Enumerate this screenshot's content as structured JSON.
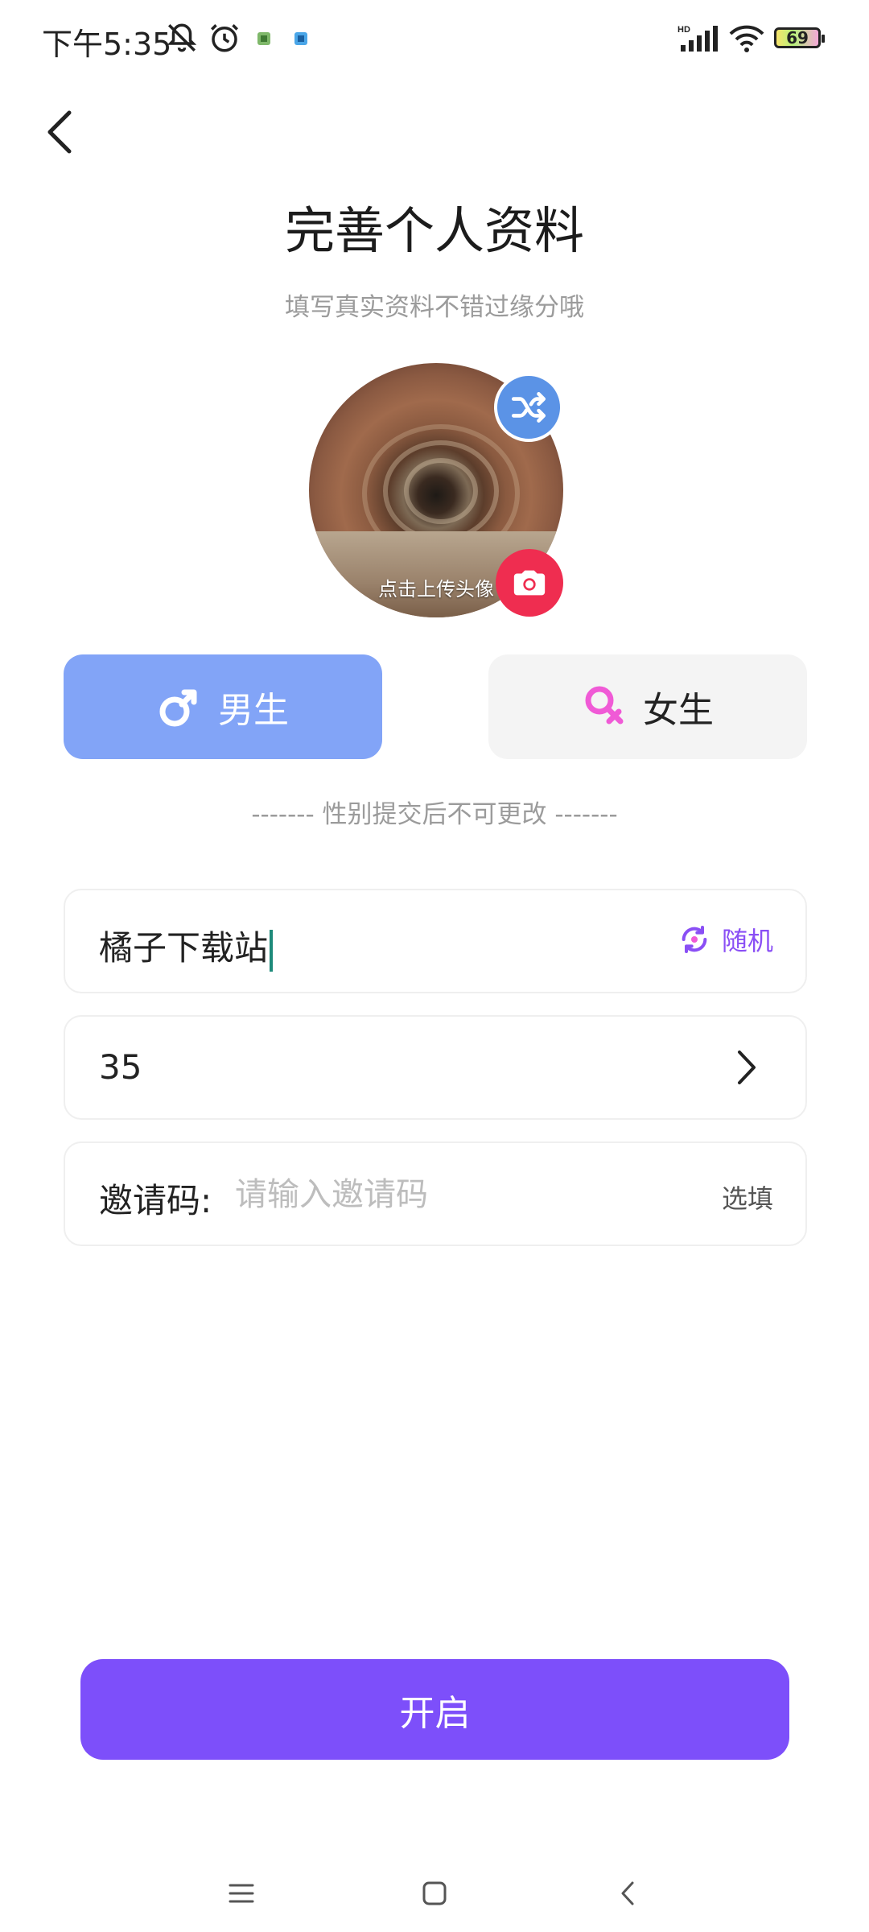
{
  "status_bar": {
    "time": "下午5:35",
    "battery_level": "69",
    "icons": [
      "mute-icon",
      "alarm-icon",
      "app-notification-icon",
      "app-notification-icon",
      "hd-signal-icon",
      "wifi-icon",
      "battery-icon"
    ]
  },
  "header": {
    "title": "完善个人资料",
    "subtitle": "填写真实资料不错过缘分哦"
  },
  "avatar": {
    "caption": "点击上传头像",
    "shuffle_icon": "shuffle-icon",
    "camera_icon": "camera-icon"
  },
  "gender": {
    "male_label": "男生",
    "female_label": "女生",
    "selected": "male",
    "note": "------- 性别提交后不可更改 -------"
  },
  "form": {
    "nickname_value": "橘子下载站",
    "random_label": "随机",
    "age_value": "35",
    "invite_label": "邀请码:",
    "invite_placeholder": "请输入邀请码",
    "invite_optional": "选填"
  },
  "submit_label": "开启",
  "colors": {
    "primary": "#7d4ffa",
    "male_active": "#82a4f7",
    "female_pink": "#f05ad6",
    "camera_red": "#ef2d50",
    "shuffle_blue": "#5b93e6"
  }
}
